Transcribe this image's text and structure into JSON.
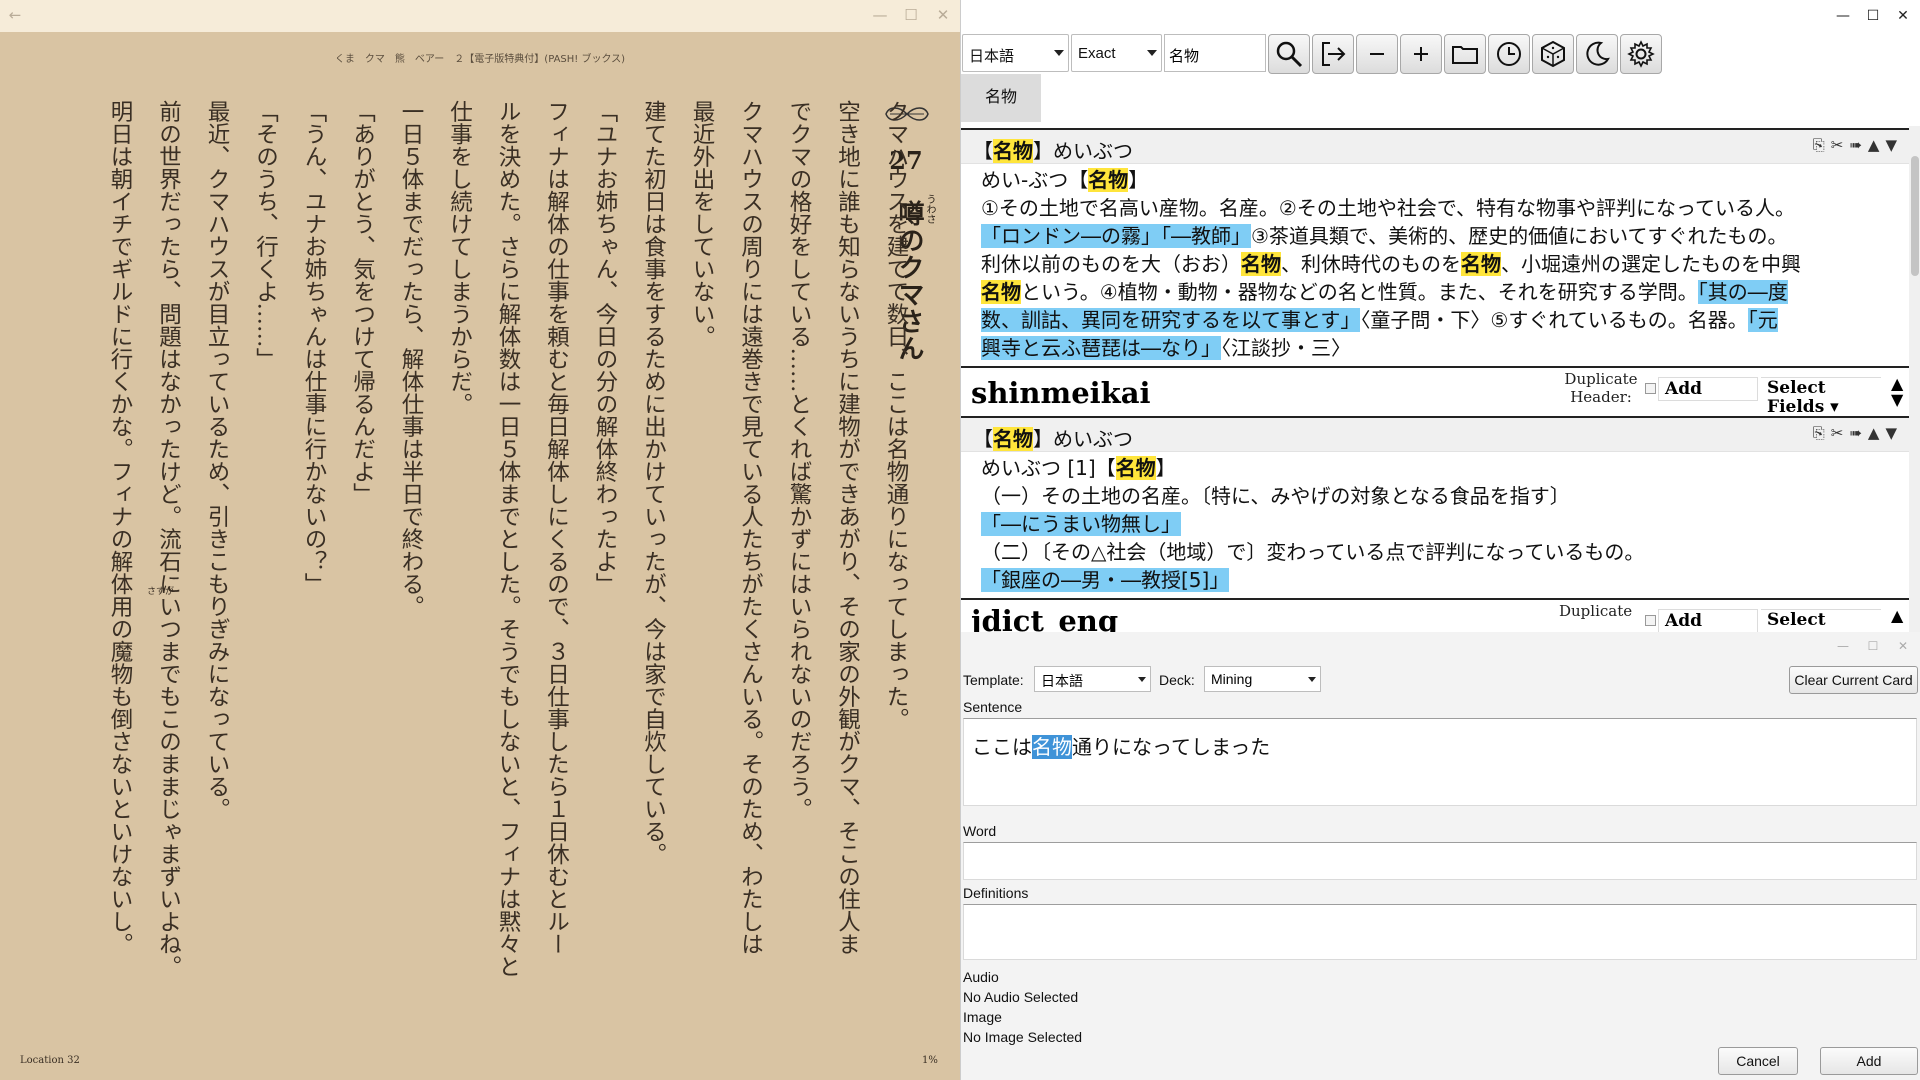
{
  "reader": {
    "book_title": "くま　クマ　熊　ベアー　２【電子版特典付】(PASH! ブックス)",
    "chapter_number": "27",
    "chapter_title": "噂のクマさん",
    "chapter_furigana": "うわさ",
    "columns": [
      "クマハウスを建てて数日、ここは名物通りになってしまった。",
      "空き地に誰も知らないうちに建物ができあがり、その家の外観がクマ、そこの住人ま",
      "でクマの格好をしている……とくれば驚かずにはいられないのだろう。",
      "クマハウスの周りには遠巻きで見ている人たちがたくさんいる。そのため、わたしは",
      "最近外出をしていない。",
      "建てた初日は食事をするために出かけていったが、今は家で自炊している。",
      "「ユナお姉ちゃん、今日の分の解体終わったよ」",
      "フィナは解体の仕事を頼むと毎日解体しにくるので、３日仕事したら１日休むとルー",
      "ルを決めた。さらに解体数は一日５体までとした。そうでもしないと、フィナは黙々と",
      "仕事をし続けてしまうからだ。",
      "一日５体までだったら、解体仕事は半日で終わる。",
      "「ありがとう、気をつけて帰るんだよ」",
      "「うん、ユナお姉ちゃんは仕事に行かないの？」",
      "「そのうち、行くよ……」",
      "最近、クマハウスが目立っているため、引きこもりぎみになっている。",
      "前の世界だったら、問題はなかったけど。流石にいつまでもこのままじゃまずいよね。",
      "明日は朝イチでギルドに行くかな。フィナの解体用の魔物も倒さないといけないし。"
    ],
    "furigana_sasuga": "さすが",
    "location": "Location 32",
    "percent": "1%"
  },
  "dictionary": {
    "language": "日本語",
    "match_mode": "Exact",
    "search_query": "名物",
    "tab_label": "名物",
    "entries": [
      {
        "head_open": "【",
        "head_term": "名物",
        "head_rest": "】めいぶつ",
        "lines": [
          {
            "parts": [
              [
                "t",
                "めい-ぶつ【"
              ],
              [
                "h2",
                "名物"
              ],
              [
                "t",
                "】"
              ]
            ]
          },
          {
            "parts": [
              [
                "t",
                "①その土地で名高い産物。名産。②その土地や社会で、特有な物事や評判になっている人。"
              ]
            ]
          },
          {
            "parts": [
              [
                "q",
                "「ロンドン―の霧」「―教師」"
              ],
              [
                "t",
                "③茶道具類で、美術的、歴史的価値においてすぐれたもの。"
              ]
            ]
          },
          {
            "parts": [
              [
                "t",
                "利休以前のものを大（おお）"
              ],
              [
                "h",
                "名物"
              ],
              [
                "t",
                "、利休時代のものを"
              ],
              [
                "h",
                "名物"
              ],
              [
                "t",
                "、小堀遠州の選定したものを中興"
              ]
            ]
          },
          {
            "parts": [
              [
                "h",
                "名物"
              ],
              [
                "t",
                "という。④植物・動物・器物などの名と性質。また、それを研究する学問。"
              ],
              [
                "q",
                "「其の―度"
              ]
            ]
          },
          {
            "parts": [
              [
                "q",
                "数、訓詁、異同を研究するを以て事とす」"
              ],
              [
                "t",
                "〈童子問・下〉⑤すぐれているもの。名器。"
              ],
              [
                "q",
                "「元"
              ]
            ]
          },
          {
            "parts": [
              [
                "q",
                "興寺と云ふ琶琵は―なり」"
              ],
              [
                "t",
                "〈江談抄・三〉"
              ]
            ]
          }
        ]
      },
      {
        "head_open": "【",
        "head_term": "名物",
        "head_rest": "】めいぶつ",
        "lines": [
          {
            "parts": [
              [
                "t",
                "めいぶつ [1]【"
              ],
              [
                "h2",
                "名物"
              ],
              [
                "t",
                "】"
              ]
            ]
          },
          {
            "parts": [
              [
                "t",
                "（一）その土地の名産。〔特に、みやげの対象となる食品を指す〕"
              ]
            ]
          },
          {
            "parts": [
              [
                "q",
                "「―にうまい物無し」"
              ]
            ]
          },
          {
            "parts": [
              [
                "t",
                "（二）〔その△社会（地域）で〕変わっている点で評判になっているもの。"
              ]
            ]
          },
          {
            "parts": [
              [
                "q",
                "「銀座の―男・―教授[5]」"
              ]
            ]
          }
        ]
      }
    ],
    "dict_names": [
      "shinmeikai",
      "jdict_eng"
    ],
    "top_clipped_text": "Fields ▾",
    "duplicate_header_label": "Duplicate Header:",
    "duplicate_label": "Duplicate",
    "add_label": "Add",
    "select_fields_label": "Select Fields ▾",
    "select_label": "Select",
    "entry_icons": "⎘✂➠▲▼"
  },
  "card": {
    "template_label": "Template:",
    "template_value": "日本語",
    "deck_label": "Deck:",
    "deck_value": "Mining",
    "clear_button": "Clear Current Card",
    "sentence_label": "Sentence",
    "sentence_before": "ここは",
    "sentence_selected": "名物",
    "sentence_after": "通りになってしまった",
    "word_label": "Word",
    "word_value": "",
    "definitions_label": "Definitions",
    "definitions_value": "",
    "audio_label": "Audio",
    "audio_status": "No Audio Selected",
    "image_label": "Image",
    "image_status": "No Image Selected",
    "cancel_button": "Cancel",
    "add_button": "Add"
  },
  "colors": {
    "reader_bg": "#d9c4a3",
    "highlight_yellow": "#ffe53b",
    "quote_blue": "#7fcdf5",
    "selection_blue": "#3f93d8"
  },
  "icons": [
    "back-arrow-icon",
    "minimize-icon",
    "maximize-icon",
    "close-icon",
    "search-icon",
    "open-popup-icon",
    "zoom-out-icon",
    "zoom-in-icon",
    "folder-icon",
    "history-icon",
    "anki-deck-icon",
    "night-mode-icon",
    "settings-gear-icon"
  ]
}
